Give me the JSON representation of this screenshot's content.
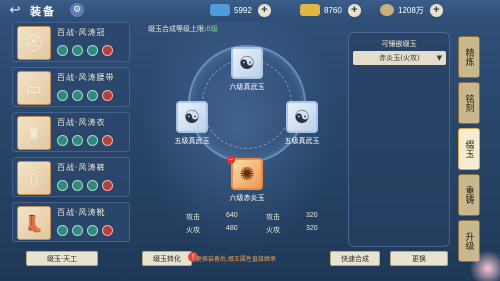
{
  "header": {
    "title": "装备",
    "back_icon": "back-arrow-icon",
    "settings_icon": "gear-icon"
  },
  "resources": [
    {
      "value": "5992",
      "icon": "blue-gem-icon",
      "color": "#4f9ad8"
    },
    {
      "value": "8760",
      "icon": "gold-ingot-icon",
      "color": "#e3b642"
    },
    {
      "value": "1208万",
      "icon": "coin-icon",
      "color": "#c8b079"
    }
  ],
  "equipment": [
    {
      "name": "百战·风涛冠",
      "icon": "helmet-icon",
      "gems": [
        "teal",
        "teal",
        "teal",
        "red"
      ]
    },
    {
      "name": "百战·风涛腰带",
      "icon": "belt-icon",
      "gems": [
        "teal",
        "teal",
        "teal",
        "red"
      ]
    },
    {
      "name": "百战·风涛衣",
      "icon": "armor-icon",
      "gems": [
        "teal",
        "teal",
        "teal",
        "red"
      ]
    },
    {
      "name": "百战·风涛裤",
      "icon": "pants-icon",
      "gems": [
        "teal",
        "teal",
        "teal",
        "red"
      ]
    },
    {
      "name": "百战·风涛靴",
      "icon": "boots-icon",
      "gems": [
        "teal",
        "teal",
        "teal",
        "red"
      ]
    }
  ],
  "inlay": {
    "limit_text": "缀玉合成等级上限:",
    "limit_value": "8级",
    "slots": [
      {
        "label": "六级真武玉",
        "icon": "yinyang-icon"
      },
      {
        "label": "五级真武玉",
        "icon": "yinyang-icon"
      },
      {
        "label": "五级真武玉",
        "icon": "yinyang-icon"
      },
      {
        "label": "六级赤炎玉",
        "icon": "fire-jade-icon"
      }
    ],
    "stats": [
      [
        "攻击",
        "640",
        "攻击",
        "320"
      ],
      [
        "火攻",
        "480",
        "火攻",
        "320"
      ]
    ]
  },
  "side_panel": {
    "title": "可镶嵌缀玉",
    "selected": "赤炎玉(火攻)"
  },
  "tabs": [
    "精炼",
    "铭刻",
    "缀玉",
    "重铸",
    "升级"
  ],
  "active_tab": 2,
  "bottom": {
    "btn_jade_sky": "缀玉·天工",
    "btn_convert": "缀玉转化",
    "note": "更换装备后,缀玉属性直接继承",
    "btn_fast": "快速合成",
    "btn_replace": "更换"
  }
}
